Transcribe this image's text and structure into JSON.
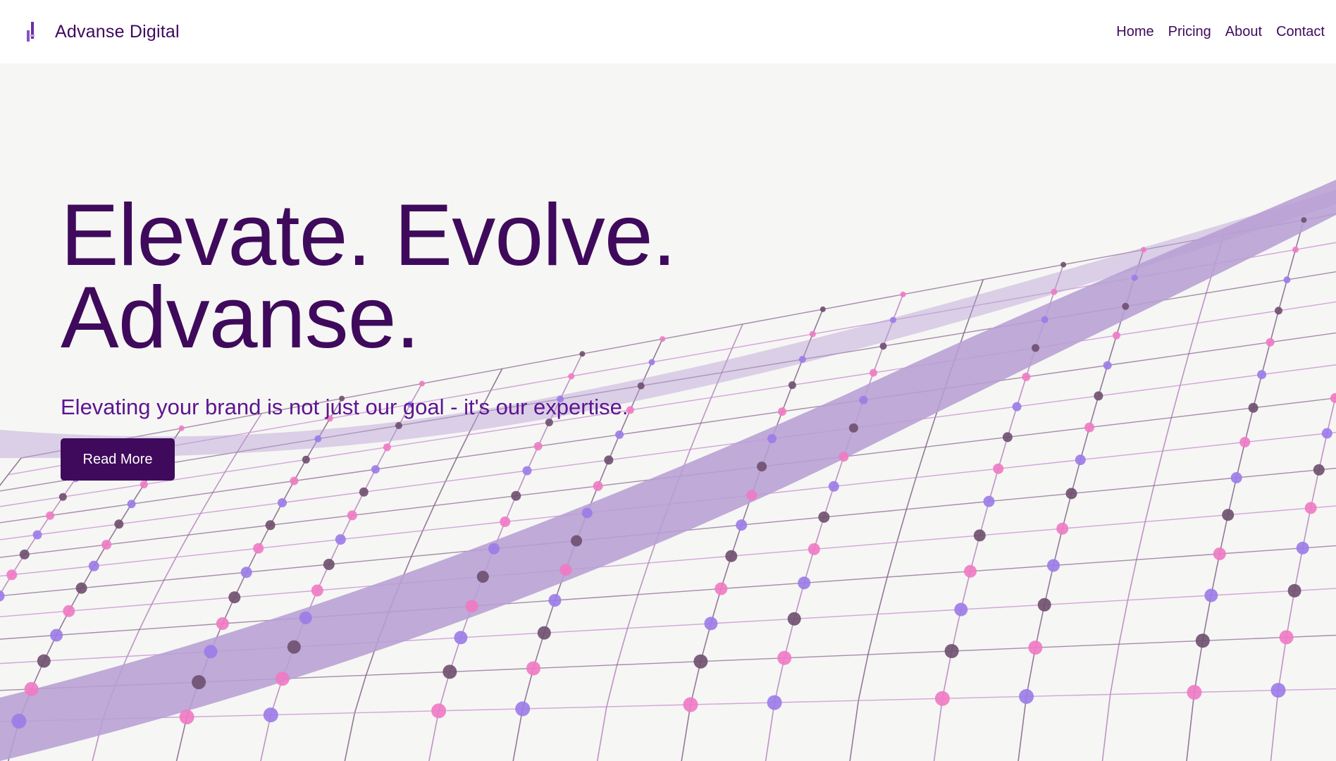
{
  "brand": {
    "name": "Advanse Digital",
    "logo_icon": "tower-logo-icon"
  },
  "nav": {
    "items": [
      "Home",
      "Pricing",
      "About",
      "Contact"
    ]
  },
  "hero": {
    "headline_line1": "Elevate. Evolve.",
    "headline_line2": "Advanse.",
    "subheadline": "Elevating your brand is not just our goal - it's our expertise.",
    "cta_label": "Read More"
  },
  "colors": {
    "primary": "#3f0a5c",
    "subheadline": "#5d1490",
    "band": "#b79fd4",
    "node_pink": "#f07ac4",
    "node_violet": "#9b7be8",
    "node_dark": "#6e4f6e",
    "background": "#f6f6f4"
  }
}
